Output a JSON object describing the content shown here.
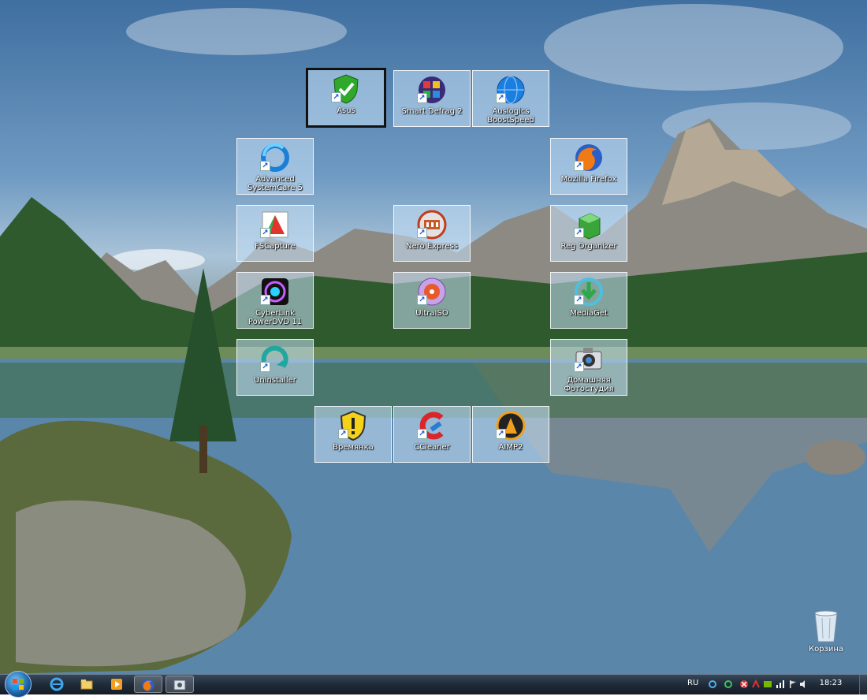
{
  "desktop": {
    "icons": [
      {
        "label": "Asus",
        "icon": "shield-check-icon",
        "selected": true
      },
      {
        "label": "Smart Defrag 2",
        "icon": "defrag-cube-icon"
      },
      {
        "label": "Auslogics BoostSpeed",
        "icon": "globe-icon"
      },
      {
        "label": "Advanced SystemCare 5",
        "icon": "refresh-ring-icon"
      },
      {
        "label": "Mozilla Firefox",
        "icon": "firefox-icon"
      },
      {
        "label": "FSCapture",
        "icon": "capture-fan-icon"
      },
      {
        "label": "Nero Express",
        "icon": "colosseum-icon"
      },
      {
        "label": "Reg Organizer",
        "icon": "green-cube-icon"
      },
      {
        "label": "CyberLink PowerDVD 11",
        "icon": "dvd-eye-icon"
      },
      {
        "label": "UltraISO",
        "icon": "disc-icon"
      },
      {
        "label": "MediaGet",
        "icon": "download-arrow-icon"
      },
      {
        "label": "Uninstaller",
        "icon": "swirl-icon"
      },
      {
        "label": "Домашняя Фотостудия",
        "icon": "camera-icon"
      },
      {
        "label": "Времянка",
        "icon": "warning-shield-icon"
      },
      {
        "label": "CCleaner",
        "icon": "ccleaner-icon"
      },
      {
        "label": "AIMP2",
        "icon": "aimp-icon"
      }
    ],
    "recycle_bin": {
      "label": "Корзина",
      "icon": "recycle-bin-icon"
    }
  },
  "taskbar": {
    "pinned": [
      {
        "name": "internet-explorer",
        "icon": "ie-icon"
      },
      {
        "name": "explorer",
        "icon": "folder-icon"
      },
      {
        "name": "media-player",
        "icon": "media-player-icon"
      },
      {
        "name": "firefox",
        "icon": "firefox-icon",
        "active": true
      },
      {
        "name": "app",
        "icon": "app-window-icon",
        "active": true
      }
    ],
    "tray": {
      "language": "RU",
      "clock": "18:23",
      "icons": [
        "sync-icon",
        "green-circle-icon",
        "cancel-icon",
        "arrow-icon",
        "nvidia-icon",
        "network-icon",
        "flag-icon",
        "volume-icon"
      ]
    }
  }
}
